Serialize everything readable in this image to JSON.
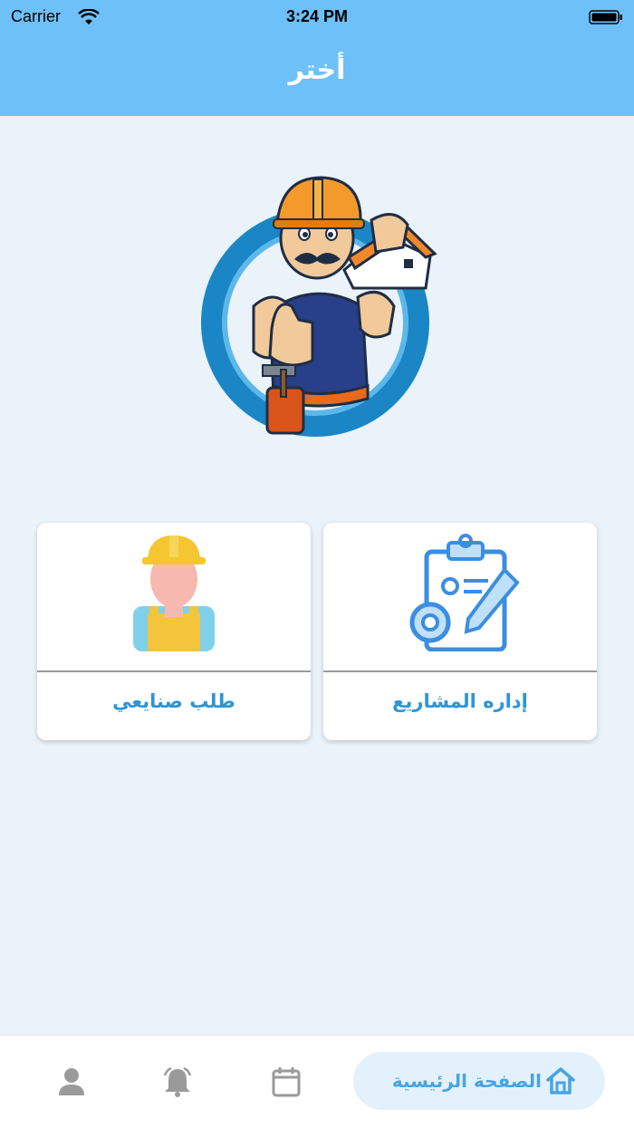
{
  "status_bar": {
    "carrier": "Carrier",
    "time": "3:24 PM"
  },
  "header": {
    "title": "أختر"
  },
  "cards": [
    {
      "label": "طلب صنايعي",
      "icon": "worker-icon"
    },
    {
      "label": "إداره المشاريع",
      "icon": "project-management-icon"
    }
  ],
  "tab_bar": {
    "home_label": "الصفحة الرئيسية",
    "items": [
      "profile-icon",
      "notifications-icon",
      "calendar-icon",
      "home-icon"
    ]
  },
  "colors": {
    "header": "#6ec0f8",
    "background": "#eaf2fa",
    "accent": "#2d95d6"
  }
}
